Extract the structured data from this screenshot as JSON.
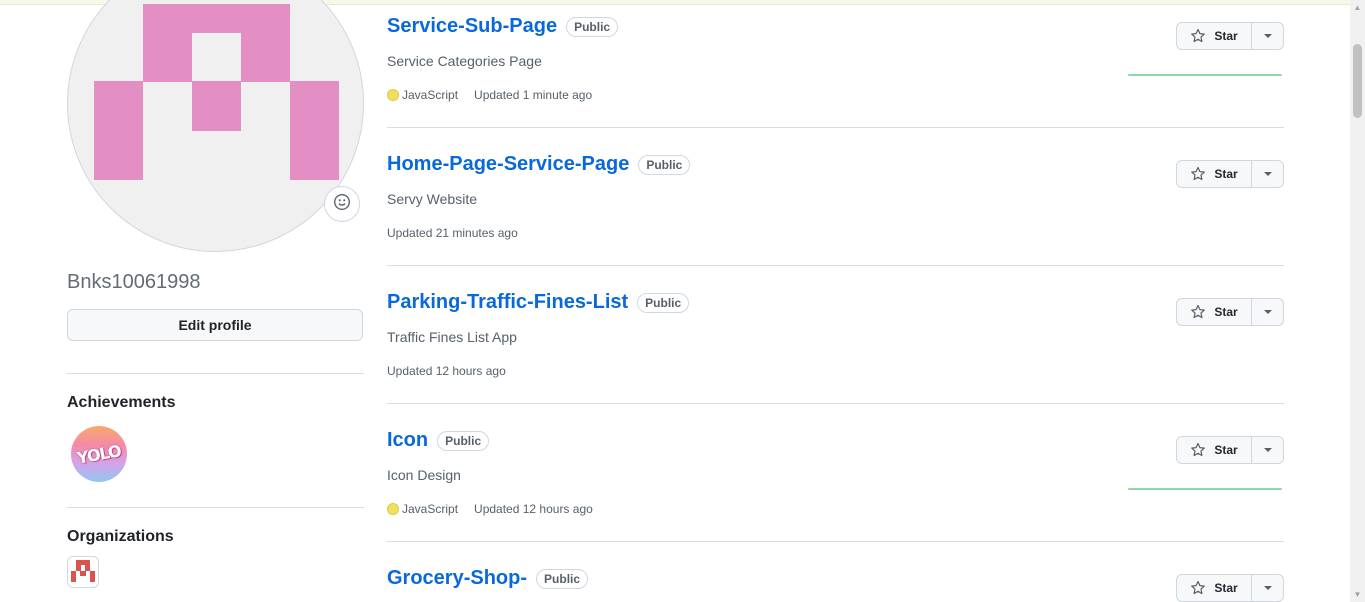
{
  "profile": {
    "username": "Bnks10061998",
    "edit_profile_label": "Edit profile",
    "status_icon": "smiley-icon"
  },
  "achievements": {
    "title": "Achievements",
    "badge_text": "YOLO"
  },
  "organizations": {
    "title": "Organizations"
  },
  "repos": [
    {
      "name": "Service-Sub-Page",
      "visibility": "Public",
      "description": "Service Categories Page",
      "language": "JavaScript",
      "language_color": "#f1e05a",
      "updated": "Updated 1 minute ago",
      "star_label": "Star"
    },
    {
      "name": "Home-Page-Service-Page",
      "visibility": "Public",
      "description": "Servy Website",
      "language": "",
      "updated": "Updated 21 minutes ago",
      "star_label": "Star"
    },
    {
      "name": "Parking-Traffic-Fines-List",
      "visibility": "Public",
      "description": "Traffic Fines List App",
      "language": "",
      "updated": "Updated 12 hours ago",
      "star_label": "Star"
    },
    {
      "name": "Icon",
      "visibility": "Public",
      "description": "Icon Design",
      "language": "JavaScript",
      "language_color": "#f1e05a",
      "updated": "Updated 12 hours ago",
      "star_label": "Star"
    },
    {
      "name": "Grocery-Shop-",
      "visibility": "Public",
      "description": "",
      "language": "",
      "updated": "",
      "star_label": "Star"
    }
  ],
  "colors": {
    "link": "#0969da",
    "avatar_pink": "#e38fc3",
    "javascript": "#f1e05a",
    "sparkline": "#8fd9a8"
  }
}
